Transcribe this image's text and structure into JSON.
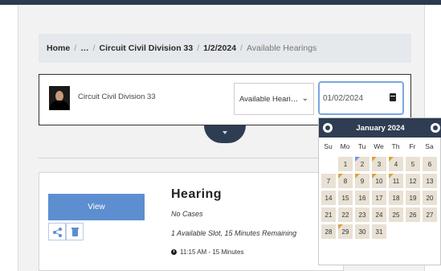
{
  "breadcrumb": {
    "home": "Home",
    "ellipsis": "…",
    "division": "Circuit Civil Division 33",
    "date": "1/2/2024",
    "current": "Available Hearings",
    "separator": "/"
  },
  "filter": {
    "judge_name": "Circuit Civil Division 33",
    "select_value": "Available Heari…",
    "date_value": "01/02/2024"
  },
  "card": {
    "view_label": "View",
    "title": "Hearing",
    "cases": "No Cases",
    "slots": "1 Available Slot, 15 Minutes Remaining",
    "time": "11:15 AM - 15 Minutes"
  },
  "datepicker": {
    "month_label": "January 2024",
    "weekdays": [
      "Su",
      "Mo",
      "Tu",
      "We",
      "Th",
      "Fr",
      "Sa"
    ],
    "weeks": [
      [
        "",
        "1",
        "2",
        "3",
        "4",
        "5",
        "6"
      ],
      [
        "7",
        "8",
        "9",
        "10",
        "11",
        "12",
        "13"
      ],
      [
        "14",
        "15",
        "16",
        "17",
        "18",
        "19",
        "20"
      ],
      [
        "21",
        "22",
        "23",
        "24",
        "25",
        "26",
        "27"
      ],
      [
        "28",
        "29",
        "30",
        "31",
        "",
        "",
        ""
      ]
    ],
    "marked_days": [
      "2",
      "3",
      "4",
      "8",
      "9",
      "10",
      "11",
      "29"
    ],
    "selected_day": "2"
  },
  "colors": {
    "accent": "#5d8ed0",
    "header_dark": "#2e3d52",
    "marker": "#e0a03a"
  }
}
